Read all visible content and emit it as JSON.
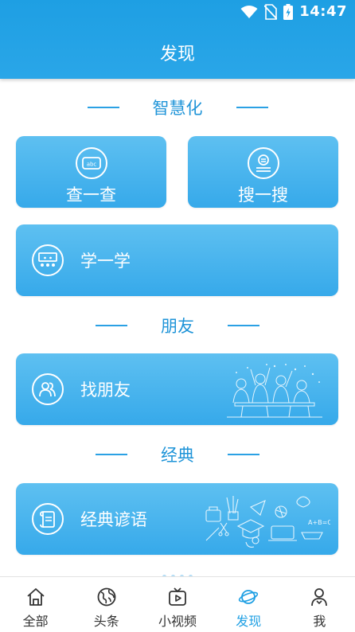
{
  "status_bar": {
    "time": "14:47",
    "icons": [
      "wifi-icon",
      "no-sim-icon",
      "battery-charging-icon"
    ]
  },
  "header": {
    "title": "发现"
  },
  "sections": {
    "smart": {
      "title": "智慧化"
    },
    "friends": {
      "title": "朋友"
    },
    "classic": {
      "title": "经典"
    }
  },
  "cards": {
    "lookup": {
      "label": "查一查",
      "icon": "abc-dictionary-icon"
    },
    "search": {
      "label": "搜一搜",
      "icon": "search-person-icon"
    },
    "study": {
      "label": "学一学",
      "icon": "classroom-icon"
    },
    "find_friends": {
      "label": "找朋友",
      "icon": "people-icon"
    },
    "proverbs": {
      "label": "经典谚语",
      "icon": "scroll-icon"
    }
  },
  "bottom_nav": {
    "items": [
      {
        "label": "全部",
        "icon": "home-icon"
      },
      {
        "label": "头条",
        "icon": "globe-icon"
      },
      {
        "label": "小视频",
        "icon": "tv-icon"
      },
      {
        "label": "发现",
        "icon": "planet-icon",
        "active": true
      },
      {
        "label": "我",
        "icon": "user-icon"
      }
    ]
  },
  "colors": {
    "primary": "#1e9fe3",
    "card": "#44b2ec",
    "section_text": "#1f94d8"
  }
}
